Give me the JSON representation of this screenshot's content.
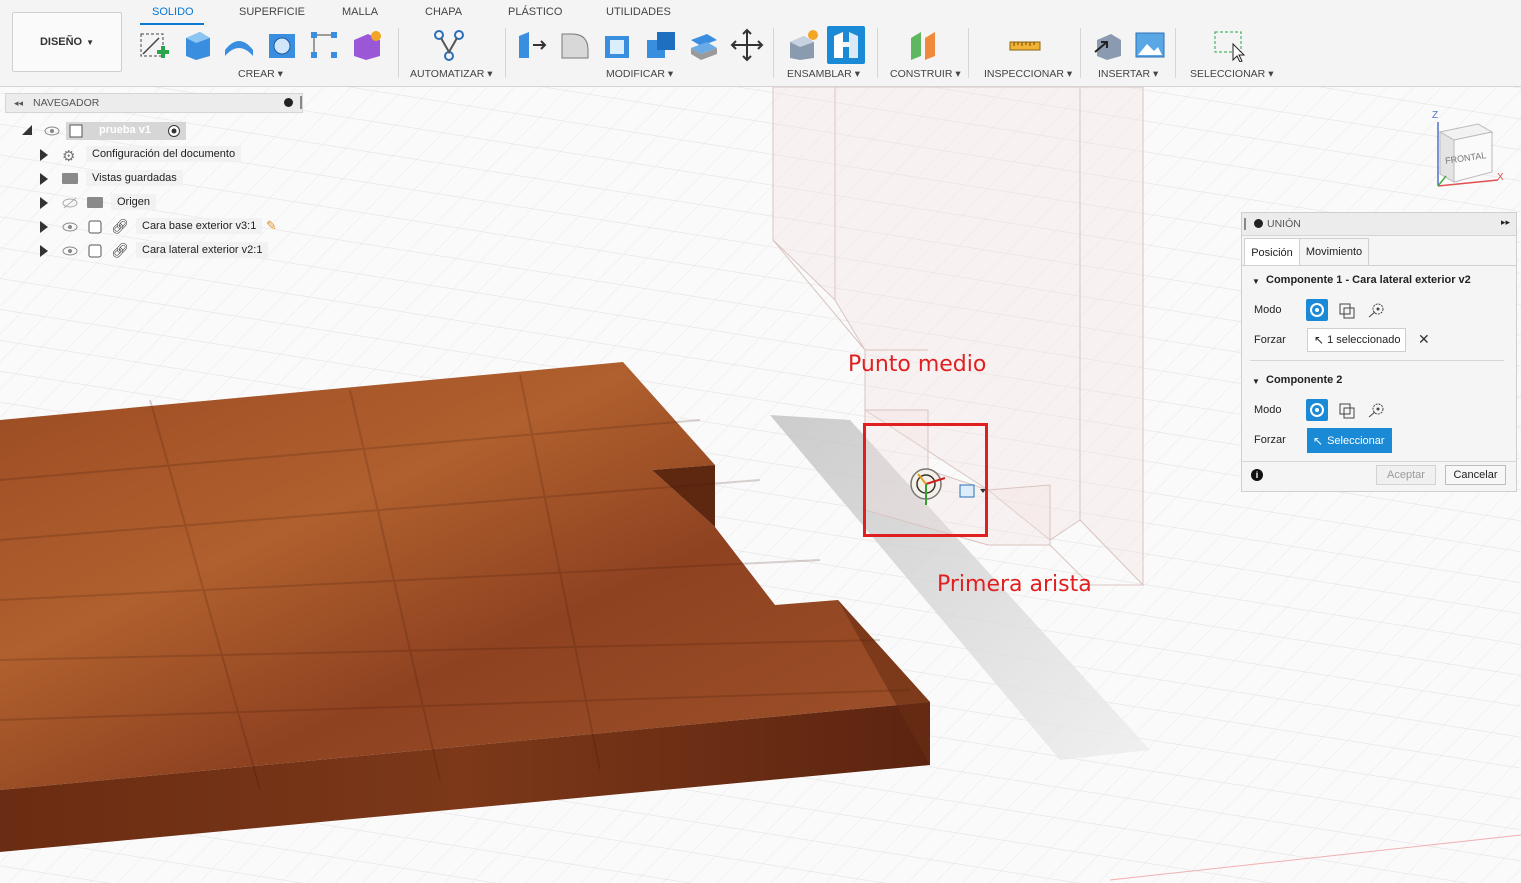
{
  "toolbar": {
    "workspace": "DISEÑO",
    "tabs": [
      "SOLIDO",
      "SUPERFICIE",
      "MALLA",
      "CHAPA",
      "PLÁSTICO",
      "UTILIDADES"
    ],
    "groups": {
      "crear": "CREAR",
      "automatizar": "AUTOMATIZAR",
      "modificar": "MODIFICAR",
      "ensamblar": "ENSAMBLAR",
      "construir": "CONSTRUIR",
      "inspeccionar": "INSPECCIONAR",
      "insertar": "INSERTAR",
      "seleccionar": "SELECCIONAR"
    }
  },
  "navigator": {
    "title": "NAVEGADOR",
    "root": "prueba v1",
    "items": [
      {
        "label": "Configuración del documento",
        "icon": "gear-icon"
      },
      {
        "label": "Vistas guardadas",
        "icon": "folder-icon"
      },
      {
        "label": "Origen",
        "icon": "folder-icon"
      },
      {
        "label": "Cara base exterior v3:1",
        "icon": "link-icon"
      },
      {
        "label": "Cara lateral exterior v2:1",
        "icon": "link-icon"
      }
    ]
  },
  "viewcube": {
    "face": "FRONTAL",
    "axes": {
      "x": "X",
      "z": "Z"
    }
  },
  "annotations": {
    "punto_medio": "Punto medio",
    "primera_arista": "Primera arista"
  },
  "union_panel": {
    "title": "UNIÓN",
    "tabs": [
      "Posición",
      "Movimiento"
    ],
    "component1": {
      "heading": "Componente 1 - Cara lateral exterior v2",
      "mode_label": "Modo",
      "force_label": "Forzar",
      "force_value": "1 seleccionado"
    },
    "component2": {
      "heading": "Componente 2",
      "mode_label": "Modo",
      "force_label": "Forzar",
      "force_value": "Seleccionar"
    },
    "accept": "Aceptar",
    "cancel": "Cancelar"
  },
  "colors": {
    "accent": "#0a78d0",
    "select_blue": "#1a8ad6",
    "wood": "#8a3d1e",
    "annotation_red": "#e02020"
  }
}
